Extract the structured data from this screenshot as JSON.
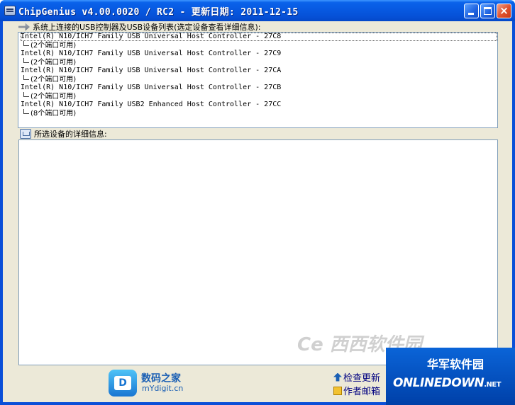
{
  "window": {
    "title": "ChipGenius v4.00.0020 / RC2 - 更新日期: 2011-12-15",
    "controls": {
      "minimize": "",
      "maximize": "",
      "close": "×"
    }
  },
  "device_list": {
    "label": "系统上连接的USB控制器及USB设备列表(选定设备查看详细信息):",
    "items": [
      {
        "name": "Intel(R) N10/ICH7 Family USB Universal Host Controller - 27C8",
        "sub": "(2个端口可用)"
      },
      {
        "name": "Intel(R) N10/ICH7 Family USB Universal Host Controller - 27C9",
        "sub": "(2个端口可用)"
      },
      {
        "name": "Intel(R) N10/ICH7 Family USB Universal Host Controller - 27CA",
        "sub": "(2个端口可用)"
      },
      {
        "name": "Intel(R) N10/ICH7 Family USB Universal Host Controller - 27CB",
        "sub": "(2个端口可用)"
      },
      {
        "name": "Intel(R) N10/ICH7 Family USB2 Enhanced Host Controller - 27CC",
        "sub": "(8个端口可用)"
      }
    ]
  },
  "details": {
    "label": "所选设备的详细信息:"
  },
  "footer": {
    "brand_name": "数码之家",
    "brand_url": "mYdigit.cn",
    "brand_logo_letter": "D",
    "check_update": "检查更新",
    "author_email": "作者邮箱"
  },
  "watermark": "Ce 西西软件园",
  "badge": {
    "cn": "华军软件园",
    "en": "ONLINEDOWN",
    "tld": ".NET"
  }
}
